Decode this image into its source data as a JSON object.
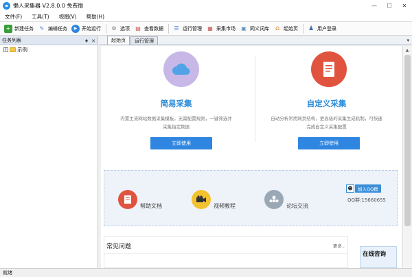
{
  "window": {
    "title": "懒人采集器 V2.8.0.0 免费版",
    "controls": {
      "minimize": "—",
      "maximize": "☐",
      "close": "✕"
    }
  },
  "menu": {
    "items": [
      {
        "label": "文件(F)"
      },
      {
        "label": "工具(T)"
      },
      {
        "label": "视图(V)"
      },
      {
        "label": "帮助(H)"
      }
    ]
  },
  "toolbar": {
    "buttons": [
      {
        "label": "新建任务",
        "icon": "new-task-icon",
        "color": "#3a9d3a",
        "glyph": "+"
      },
      {
        "label": "编辑任务",
        "icon": "edit-task-icon",
        "color": "#4a7fd0",
        "glyph": "✎"
      },
      {
        "label": "开始运行",
        "icon": "run-icon",
        "color": "#2f86e0",
        "glyph": "▶"
      },
      {
        "label": "选项",
        "icon": "options-icon",
        "color": "#777777",
        "glyph": "⚙"
      },
      {
        "label": "查看数据",
        "icon": "view-data-icon",
        "color": "#d04a4a",
        "glyph": "▤"
      },
      {
        "label": "运行管理",
        "icon": "run-manage-icon",
        "color": "#4a7fd0",
        "glyph": "☰"
      },
      {
        "label": "采集市场",
        "icon": "market-icon",
        "color": "#c0504d",
        "glyph": "▦"
      },
      {
        "label": "同义词库",
        "icon": "synonym-icon",
        "color": "#5a8fc0",
        "glyph": "▣"
      },
      {
        "label": "起始页",
        "icon": "home-icon",
        "color": "#e08a2f",
        "glyph": "⌂"
      },
      {
        "label": "用户登录",
        "icon": "user-login-icon",
        "color": "#3a6fb0",
        "glyph": "♟"
      }
    ]
  },
  "left_panel": {
    "title": "任务列表",
    "pin": "♦",
    "close": "✕",
    "tree": [
      {
        "expander": "+",
        "label": "示例"
      }
    ]
  },
  "tabs": {
    "items": [
      {
        "label": "起始页",
        "active": true
      },
      {
        "label": "运行管理",
        "active": false
      }
    ],
    "dropdown": "▾"
  },
  "start_page": {
    "cards": [
      {
        "title": "简易采集",
        "desc": "内置主流网站数据采集模板，无需配置规则，一键筛选并采集指定数据",
        "button": "立即使用",
        "icon": "cloud-icon",
        "icon_bg": "#c7b8e8"
      },
      {
        "title": "自定义采集",
        "desc": "自动分析常用网页结构，更高级的采集生成机制，可快速完成自定义采集配置",
        "button": "立即使用",
        "icon": "document-icon",
        "icon_bg": "#e0533e"
      }
    ],
    "help": {
      "items": [
        {
          "label": "帮助文档",
          "icon": "help-doc-icon",
          "color": "#e0533e"
        },
        {
          "label": "视频教程",
          "icon": "video-tutorial-icon",
          "color": "#f2c230"
        },
        {
          "label": "论坛交流",
          "icon": "forum-icon",
          "color": "#9aa7b4"
        }
      ],
      "qq_button": "加入QQ群",
      "qq_number": "QQ群:15660655"
    },
    "faq": {
      "title": "常见问题",
      "more": "更多.."
    },
    "consult": {
      "title": "在线咨询"
    }
  },
  "status": {
    "text": "就绪"
  },
  "colors": {
    "accent": "#2f86e0",
    "title_blue": "#2a8bd8"
  }
}
